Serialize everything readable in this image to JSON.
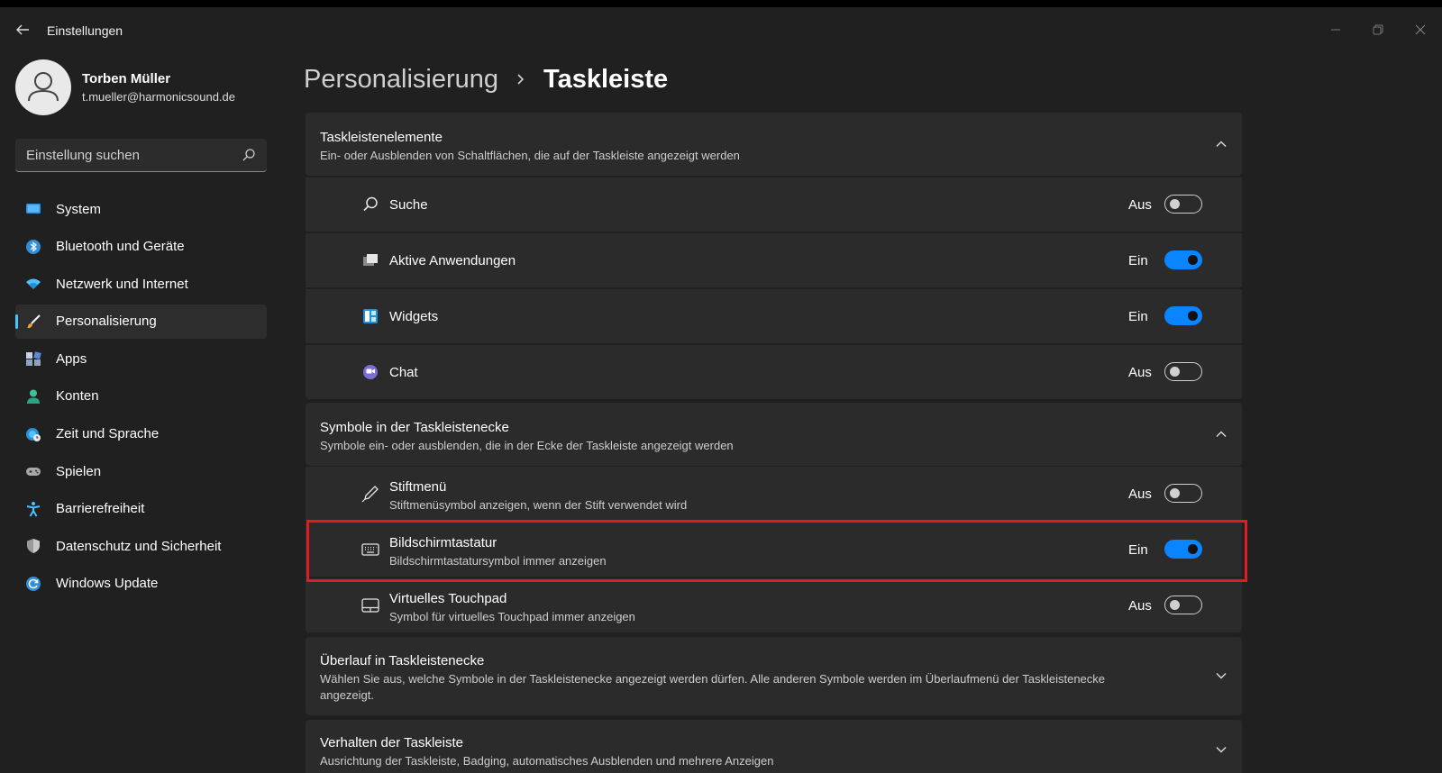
{
  "window": {
    "title": "Einstellungen"
  },
  "user": {
    "name": "Torben Müller",
    "email": "t.mueller@harmonicsound.de"
  },
  "search": {
    "placeholder": "Einstellung suchen"
  },
  "nav": {
    "items": [
      {
        "label": "System",
        "icon": "system-icon",
        "color": "#2f8fd8"
      },
      {
        "label": "Bluetooth und Geräte",
        "icon": "bluetooth-icon",
        "color": "#2f8fd8"
      },
      {
        "label": "Netzwerk und Internet",
        "icon": "wifi-icon",
        "color": "#4cc2ff"
      },
      {
        "label": "Personalisierung",
        "icon": "brush-icon",
        "color": "#e8a33c",
        "active": true
      },
      {
        "label": "Apps",
        "icon": "apps-icon",
        "color": "#8fa3bf"
      },
      {
        "label": "Konten",
        "icon": "account-icon",
        "color": "#3bc29a"
      },
      {
        "label": "Zeit und Sprache",
        "icon": "globe-clock-icon",
        "color": "#4cc2ff"
      },
      {
        "label": "Spielen",
        "icon": "gamepad-icon",
        "color": "#a8a8a8"
      },
      {
        "label": "Barrierefreiheit",
        "icon": "accessibility-icon",
        "color": "#4cc2ff"
      },
      {
        "label": "Datenschutz und Sicherheit",
        "icon": "shield-icon",
        "color": "#9a9a9a"
      },
      {
        "label": "Windows Update",
        "icon": "update-icon",
        "color": "#2f8fd8"
      }
    ]
  },
  "breadcrumb": {
    "parent": "Personalisierung",
    "current": "Taskleiste"
  },
  "sections": {
    "elements": {
      "title": "Taskleistenelemente",
      "desc": "Ein- oder Ausblenden von Schaltflächen, die auf der Taskleiste angezeigt werden",
      "rows": [
        {
          "label": "Suche",
          "state": "Aus",
          "on": false,
          "icon": "search-icon"
        },
        {
          "label": "Aktive Anwendungen",
          "state": "Ein",
          "on": true,
          "icon": "task-view-icon"
        },
        {
          "label": "Widgets",
          "state": "Ein",
          "on": true,
          "icon": "widgets-icon"
        },
        {
          "label": "Chat",
          "state": "Aus",
          "on": false,
          "icon": "chat-icon"
        }
      ]
    },
    "corner": {
      "title": "Symbole in der Taskleistenecke",
      "desc": "Symbole ein- oder ausblenden, die in der Ecke der Taskleiste angezeigt werden",
      "rows": [
        {
          "label": "Stiftmenü",
          "sub": "Stiftmenüsymbol anzeigen, wenn der Stift verwendet wird",
          "state": "Aus",
          "on": false,
          "icon": "pen-icon"
        },
        {
          "label": "Bildschirmtastatur",
          "sub": "Bildschirmtastatursymbol immer anzeigen",
          "state": "Ein",
          "on": true,
          "icon": "keyboard-icon"
        },
        {
          "label": "Virtuelles Touchpad",
          "sub": "Symbol für virtuelles Touchpad immer anzeigen",
          "state": "Aus",
          "on": false,
          "icon": "touchpad-icon"
        }
      ]
    },
    "overflow": {
      "title": "Überlauf in Taskleistenecke",
      "desc": "Wählen Sie aus, welche Symbole in der Taskleistenecke angezeigt werden dürfen. Alle anderen Symbole werden im Überlaufmenü der Taskleistenecke angezeigt."
    },
    "behavior": {
      "title": "Verhalten der Taskleiste",
      "desc": "Ausrichtung der Taskleiste, Badging, automatisches Ausblenden und mehrere Anzeigen"
    }
  },
  "colors": {
    "accent": "#0a84ff",
    "highlight": "#e11d24"
  }
}
